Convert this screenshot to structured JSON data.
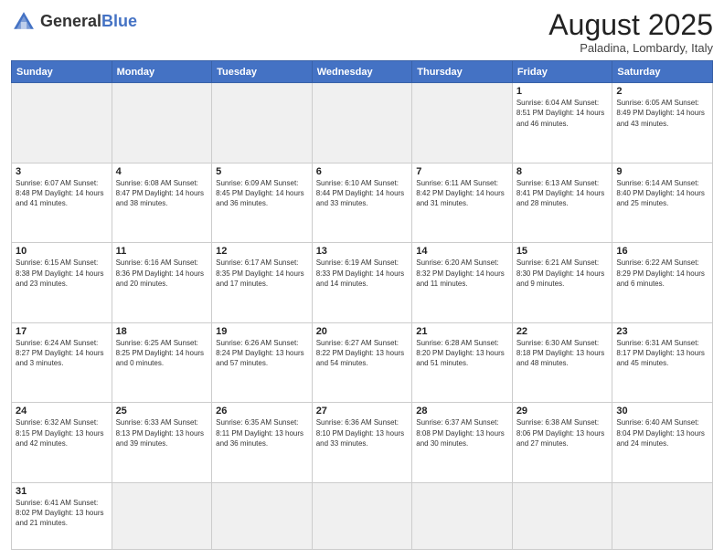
{
  "header": {
    "logo_general": "General",
    "logo_blue": "Blue",
    "title": "August 2025",
    "subtitle": "Paladina, Lombardy, Italy"
  },
  "weekdays": [
    "Sunday",
    "Monday",
    "Tuesday",
    "Wednesday",
    "Thursday",
    "Friday",
    "Saturday"
  ],
  "weeks": [
    [
      {
        "day": "",
        "info": "",
        "empty": true
      },
      {
        "day": "",
        "info": "",
        "empty": true
      },
      {
        "day": "",
        "info": "",
        "empty": true
      },
      {
        "day": "",
        "info": "",
        "empty": true
      },
      {
        "day": "",
        "info": "",
        "empty": true
      },
      {
        "day": "1",
        "info": "Sunrise: 6:04 AM\nSunset: 8:51 PM\nDaylight: 14 hours and 46 minutes."
      },
      {
        "day": "2",
        "info": "Sunrise: 6:05 AM\nSunset: 8:49 PM\nDaylight: 14 hours and 43 minutes."
      }
    ],
    [
      {
        "day": "3",
        "info": "Sunrise: 6:07 AM\nSunset: 8:48 PM\nDaylight: 14 hours and 41 minutes."
      },
      {
        "day": "4",
        "info": "Sunrise: 6:08 AM\nSunset: 8:47 PM\nDaylight: 14 hours and 38 minutes."
      },
      {
        "day": "5",
        "info": "Sunrise: 6:09 AM\nSunset: 8:45 PM\nDaylight: 14 hours and 36 minutes."
      },
      {
        "day": "6",
        "info": "Sunrise: 6:10 AM\nSunset: 8:44 PM\nDaylight: 14 hours and 33 minutes."
      },
      {
        "day": "7",
        "info": "Sunrise: 6:11 AM\nSunset: 8:42 PM\nDaylight: 14 hours and 31 minutes."
      },
      {
        "day": "8",
        "info": "Sunrise: 6:13 AM\nSunset: 8:41 PM\nDaylight: 14 hours and 28 minutes."
      },
      {
        "day": "9",
        "info": "Sunrise: 6:14 AM\nSunset: 8:40 PM\nDaylight: 14 hours and 25 minutes."
      }
    ],
    [
      {
        "day": "10",
        "info": "Sunrise: 6:15 AM\nSunset: 8:38 PM\nDaylight: 14 hours and 23 minutes."
      },
      {
        "day": "11",
        "info": "Sunrise: 6:16 AM\nSunset: 8:36 PM\nDaylight: 14 hours and 20 minutes."
      },
      {
        "day": "12",
        "info": "Sunrise: 6:17 AM\nSunset: 8:35 PM\nDaylight: 14 hours and 17 minutes."
      },
      {
        "day": "13",
        "info": "Sunrise: 6:19 AM\nSunset: 8:33 PM\nDaylight: 14 hours and 14 minutes."
      },
      {
        "day": "14",
        "info": "Sunrise: 6:20 AM\nSunset: 8:32 PM\nDaylight: 14 hours and 11 minutes."
      },
      {
        "day": "15",
        "info": "Sunrise: 6:21 AM\nSunset: 8:30 PM\nDaylight: 14 hours and 9 minutes."
      },
      {
        "day": "16",
        "info": "Sunrise: 6:22 AM\nSunset: 8:29 PM\nDaylight: 14 hours and 6 minutes."
      }
    ],
    [
      {
        "day": "17",
        "info": "Sunrise: 6:24 AM\nSunset: 8:27 PM\nDaylight: 14 hours and 3 minutes."
      },
      {
        "day": "18",
        "info": "Sunrise: 6:25 AM\nSunset: 8:25 PM\nDaylight: 14 hours and 0 minutes."
      },
      {
        "day": "19",
        "info": "Sunrise: 6:26 AM\nSunset: 8:24 PM\nDaylight: 13 hours and 57 minutes."
      },
      {
        "day": "20",
        "info": "Sunrise: 6:27 AM\nSunset: 8:22 PM\nDaylight: 13 hours and 54 minutes."
      },
      {
        "day": "21",
        "info": "Sunrise: 6:28 AM\nSunset: 8:20 PM\nDaylight: 13 hours and 51 minutes."
      },
      {
        "day": "22",
        "info": "Sunrise: 6:30 AM\nSunset: 8:18 PM\nDaylight: 13 hours and 48 minutes."
      },
      {
        "day": "23",
        "info": "Sunrise: 6:31 AM\nSunset: 8:17 PM\nDaylight: 13 hours and 45 minutes."
      }
    ],
    [
      {
        "day": "24",
        "info": "Sunrise: 6:32 AM\nSunset: 8:15 PM\nDaylight: 13 hours and 42 minutes."
      },
      {
        "day": "25",
        "info": "Sunrise: 6:33 AM\nSunset: 8:13 PM\nDaylight: 13 hours and 39 minutes."
      },
      {
        "day": "26",
        "info": "Sunrise: 6:35 AM\nSunset: 8:11 PM\nDaylight: 13 hours and 36 minutes."
      },
      {
        "day": "27",
        "info": "Sunrise: 6:36 AM\nSunset: 8:10 PM\nDaylight: 13 hours and 33 minutes."
      },
      {
        "day": "28",
        "info": "Sunrise: 6:37 AM\nSunset: 8:08 PM\nDaylight: 13 hours and 30 minutes."
      },
      {
        "day": "29",
        "info": "Sunrise: 6:38 AM\nSunset: 8:06 PM\nDaylight: 13 hours and 27 minutes."
      },
      {
        "day": "30",
        "info": "Sunrise: 6:40 AM\nSunset: 8:04 PM\nDaylight: 13 hours and 24 minutes."
      }
    ],
    [
      {
        "day": "31",
        "info": "Sunrise: 6:41 AM\nSunset: 8:02 PM\nDaylight: 13 hours and 21 minutes."
      },
      {
        "day": "",
        "info": "",
        "empty": true
      },
      {
        "day": "",
        "info": "",
        "empty": true
      },
      {
        "day": "",
        "info": "",
        "empty": true
      },
      {
        "day": "",
        "info": "",
        "empty": true
      },
      {
        "day": "",
        "info": "",
        "empty": true
      },
      {
        "day": "",
        "info": "",
        "empty": true
      }
    ]
  ]
}
